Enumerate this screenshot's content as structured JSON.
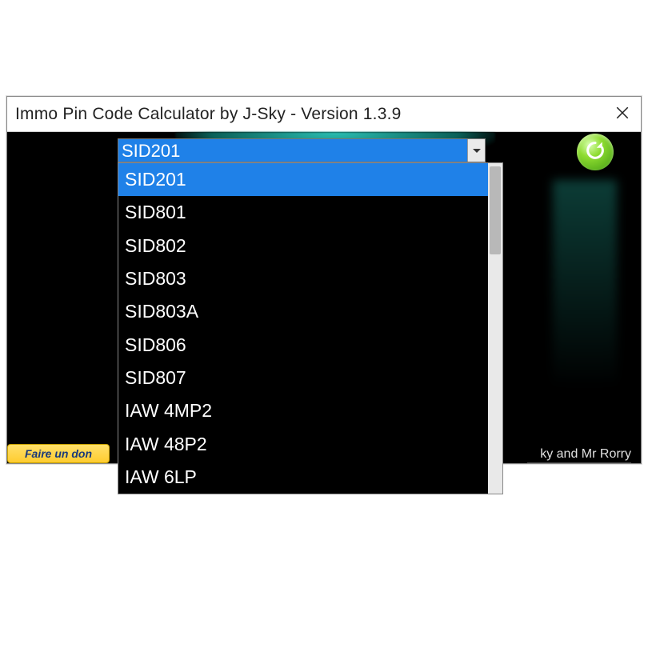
{
  "window": {
    "title": "Immo Pin Code Calculator by J-Sky  -  Version 1.3.9"
  },
  "combo": {
    "selected": "SID201",
    "options": [
      "SID201",
      "SID801",
      "SID802",
      "SID803",
      "SID803A",
      "SID806",
      "SID807",
      "IAW 4MP2",
      "IAW 48P2",
      "IAW 6LP"
    ],
    "selected_index": 0
  },
  "buttons": {
    "donate_label": "Faire un don",
    "refresh_icon": "refresh-icon"
  },
  "footer": {
    "credits": "ky and Mr Rorry"
  },
  "colors": {
    "selection": "#1f81e8",
    "accent_green": "#6fc420",
    "teal_bg": "#2fd6c9"
  }
}
